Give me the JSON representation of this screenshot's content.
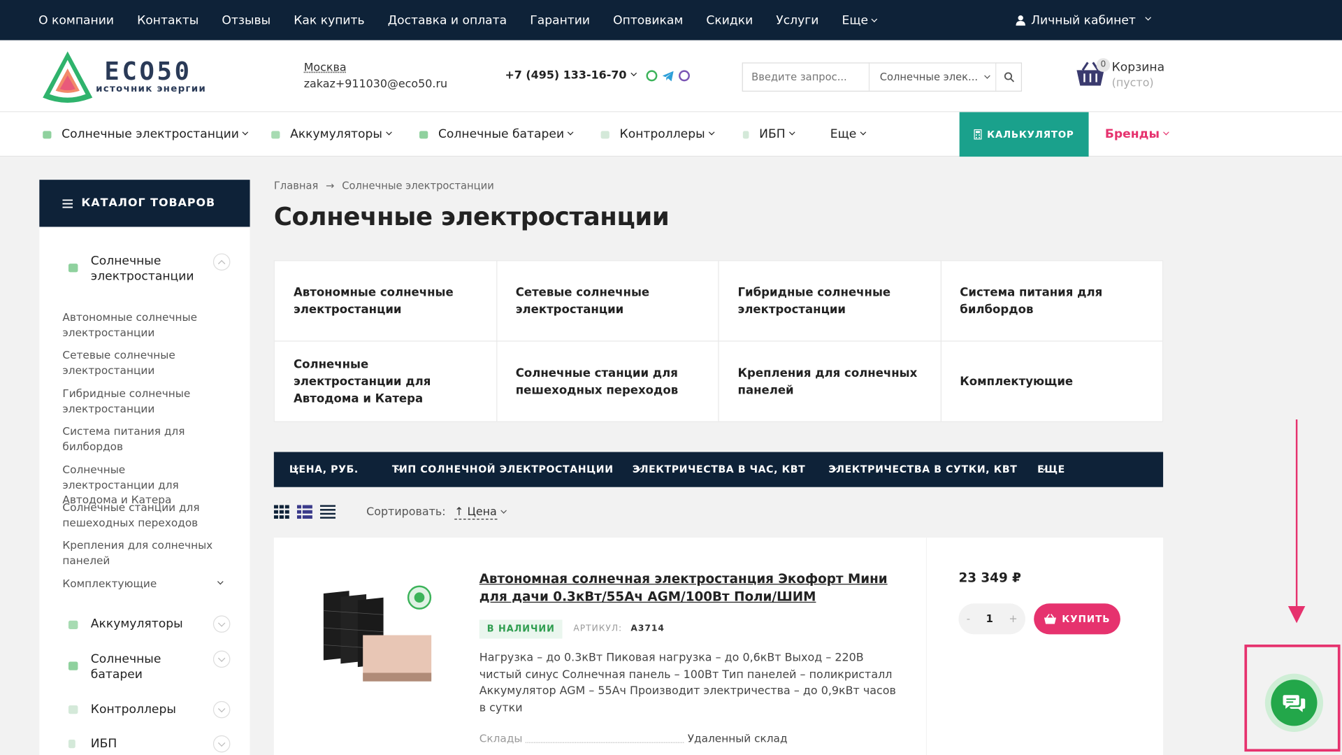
{
  "topnav": {
    "items": [
      "О компании",
      "Контакты",
      "Отзывы",
      "Как купить",
      "Доставка и оплата",
      "Гарантии",
      "Оптовикам",
      "Скидки",
      "Услуги",
      "Еще"
    ],
    "account": "Личный кабинет"
  },
  "header": {
    "logo_text": "ECO50",
    "logo_sub": "источник энергии",
    "city": "Москва",
    "email": "zakaz+911030@eco50.ru",
    "phone": "+7 (495) 133-16-70",
    "search_placeholder": "Введите запрос...",
    "search_category": "Солнечные элек...",
    "cart_label": "Корзина",
    "cart_status": "(пусто)",
    "cart_count": "0"
  },
  "catbar": {
    "items": [
      "Солнечные электростанции",
      "Аккумуляторы",
      "Солнечные батареи",
      "Контроллеры",
      "ИБП",
      "Еще"
    ],
    "calc": "КАЛЬКУЛЯТОР",
    "brands": "Бренды"
  },
  "sidebar": {
    "title": "КАТАЛОГ ТОВАРОВ",
    "active": "Солнечные электростанции",
    "subitems": [
      "Автономные солнечные электростанции",
      "Сетевые солнечные электростанции",
      "Гибридные солнечные электростанции",
      "Система питания для билбордов",
      "Солнечные электростанции для Автодома и Катера",
      "Солнечные станции для пешеходных переходов",
      "Крепления для солнечных панелей",
      "Комплектующие"
    ],
    "others": [
      "Аккумуляторы",
      "Солнечные батареи",
      "Контроллеры",
      "ИБП"
    ]
  },
  "breadcrumb": {
    "home": "Главная",
    "arrow": "→",
    "current": "Солнечные электростанции"
  },
  "page_title": "Солнечные электростанции",
  "subcategories": [
    "Автономные солнечные электростанции",
    "Сетевые солнечные электростанции",
    "Гибридные солнечные электростанции",
    "Система питания для билбордов",
    "Солнечные электростанции для Автодома и Катера",
    "Солнечные станции для пешеходных переходов",
    "Крепления для солнечных панелей",
    "Комплектующие"
  ],
  "filters": [
    "ЦЕНА, РУБ.",
    "ТИП СОЛНЕЧНОЙ ЭЛЕКТРОСТАНЦИИ",
    "ЭЛЕКТРИЧЕСТВА В ЧАС, КВТ",
    "ЭЛЕКТРИЧЕСТВА В СУТКИ, КВТ",
    "ЕЩЕ"
  ],
  "sort": {
    "label": "Сортировать:",
    "value": "Цена"
  },
  "product": {
    "title": "Автономная солнечная электростанция Экофорт Мини для дачи 0.3кВт/55Ач AGM/100Вт Поли/ШИМ",
    "stock": "В НАЛИЧИИ",
    "article_label": "АРТИКУЛ:",
    "article": "А3714",
    "description": "Нагрузка – до 0.3кВт Пиковая нагрузка – до 0,6кВт Выход – 220В чистый синус Солнечная панель – 100Вт Тип панелей – поликристалл Аккумулятор AGM – 55Ач Производит электричества – до 0,9кВт часов в сутки",
    "warehouse_label": "Склады",
    "warehouse_value": "Удаленный склад",
    "price": "23 349 ₽",
    "qty": "1",
    "qty_minus": "-",
    "qty_plus": "+",
    "buy": "КУПИТЬ"
  },
  "colors": {
    "navy": "#0e2238",
    "accent": "#e6326e",
    "teal": "#1aa18c",
    "green": "#23a74a"
  },
  "icons": {
    "chat": "chat-bubbles-icon",
    "cart": "basket-icon",
    "search": "search-icon",
    "user": "user-icon"
  }
}
